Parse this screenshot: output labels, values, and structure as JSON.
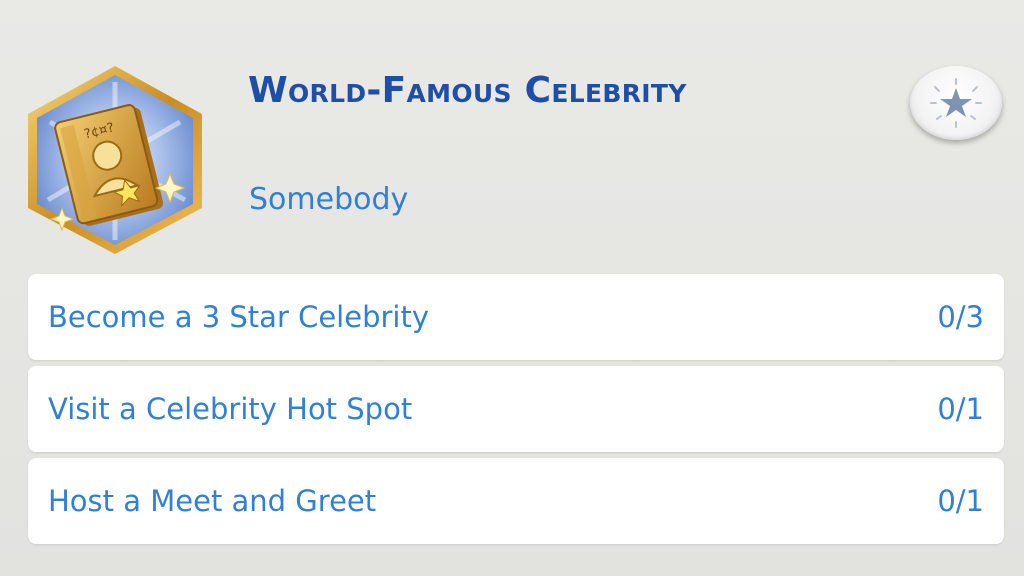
{
  "aspiration": {
    "title": "World-Famous Celebrity",
    "tier": "Somebody",
    "badge_icon": "celebrity-book-icon",
    "action_icon": "star-icon"
  },
  "goals": [
    {
      "label": "Become a 3 Star Celebrity",
      "progress": "0/3"
    },
    {
      "label": "Visit a Celebrity Hot Spot",
      "progress": "0/1"
    },
    {
      "label": "Host a Meet and Greet",
      "progress": "0/1"
    }
  ],
  "colors": {
    "title": "#1f4ea6",
    "text": "#2f80d6",
    "badge_gold": "#d9a534",
    "badge_blue": "#9fb8e6"
  }
}
